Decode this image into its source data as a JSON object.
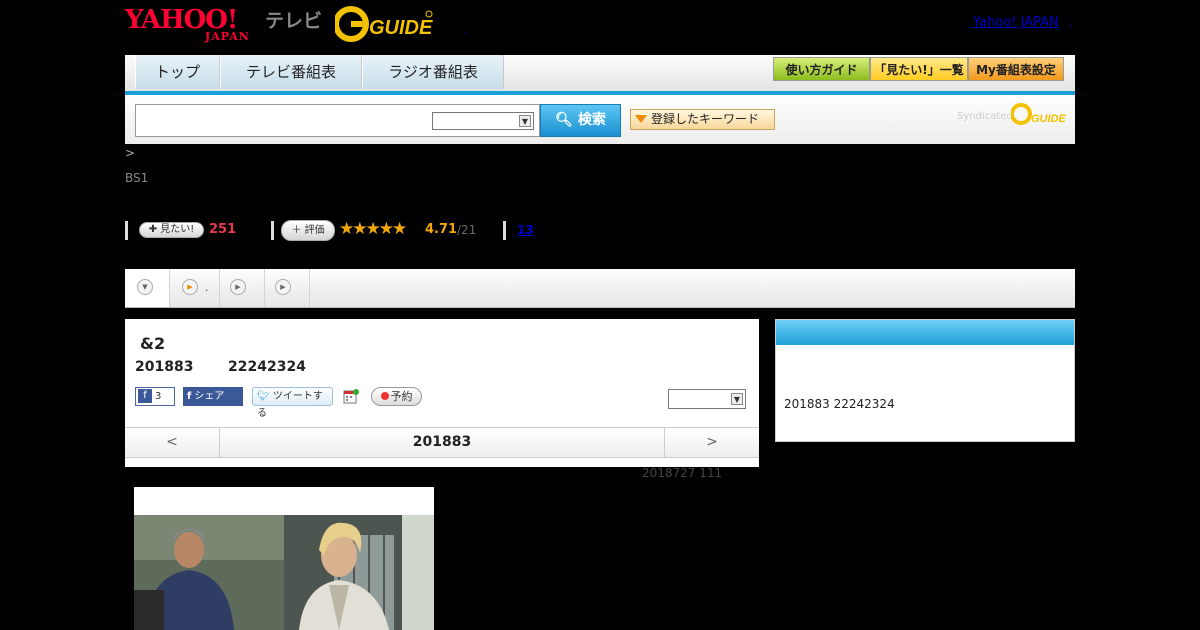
{
  "header": {
    "yahoo_logo_main": "YAHOO!",
    "yahoo_logo_sub": "JAPAN",
    "tv_label": "テレビ",
    "gguide_logo": "G GUIDE",
    "dot": ".",
    "yahoo_japan_link": "Yahoo! JAPAN",
    "comma": ","
  },
  "nav": {
    "tabs": [
      {
        "label": "トップ"
      },
      {
        "label": "テレビ番組表"
      },
      {
        "label": "ラジオ番組表"
      }
    ],
    "buttons": {
      "guide": "使い方ガイド",
      "mitai_list": "「見たい!」一覧",
      "my_tv": "My番組表設定"
    }
  },
  "search": {
    "input_value": "",
    "select_value": "",
    "button_label": "検索",
    "keyword_label": "登録したキーワード",
    "syndicated": "Syndicated",
    "gguide_small": "GUIDE"
  },
  "breadcrumb": ">",
  "channel": "BS1",
  "stats": {
    "mitai_label": "見たい!",
    "mitai_count": "251",
    "rate_label": "評価",
    "stars": "★★★★★",
    "rating": "4.71",
    "rating_count": "/21",
    "comment_count": "13"
  },
  "tabs": {
    "tab2_label": "."
  },
  "program": {
    "title": "&2",
    "date": "201883",
    "time": "22242324",
    "fb_like_count": "3",
    "fb_share_label": "シェア",
    "tweet_label": "ツイートする",
    "reserve_label": "予約",
    "select_value": "",
    "prev_label": "<",
    "current_date": "201883",
    "next_label": ">"
  },
  "updated": "2018727  111",
  "side": {
    "text": "201883  22242324"
  },
  "colors": {
    "accent_blue": "#1aa0d9",
    "rating_orange": "#f1a60a",
    "mitai_red": "#e8384f",
    "yahoo_red": "#ff0033"
  }
}
